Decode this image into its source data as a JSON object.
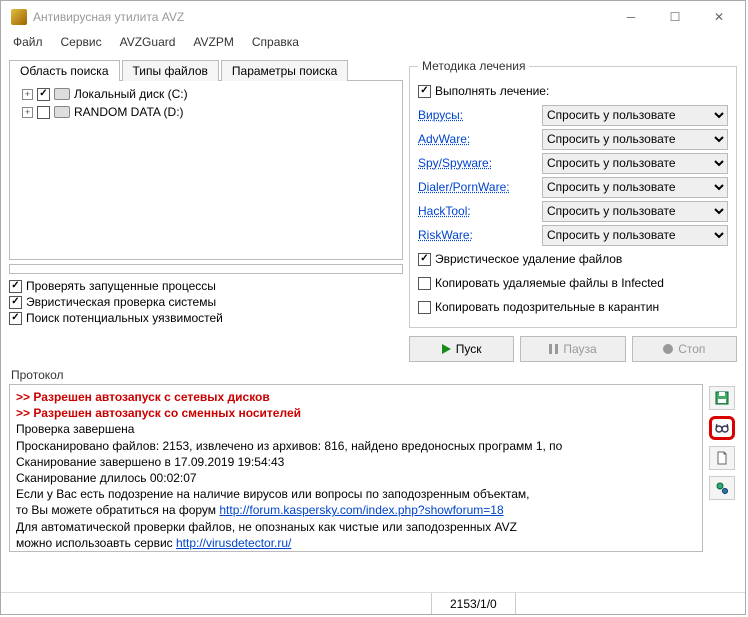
{
  "window": {
    "title": "Антивирусная утилита AVZ"
  },
  "menu": {
    "file": "Файл",
    "service": "Сервис",
    "avzguard": "AVZGuard",
    "avzpm": "AVZPM",
    "help": "Справка"
  },
  "tabs": {
    "area": "Область поиска",
    "types": "Типы файлов",
    "params": "Параметры поиска"
  },
  "tree": {
    "drive_c": "Локальный диск (C:)",
    "drive_d": "RANDOM DATA (D:)"
  },
  "checks": {
    "processes": "Проверять запущенные процессы",
    "heuristic": "Эвристическая проверка системы",
    "vuln": "Поиск потенциальных уязвимостей"
  },
  "cure": {
    "legend": "Методика лечения",
    "perform": "Выполнять лечение:",
    "rows": {
      "virus": "Вирусы:",
      "adware": "AdvWare:",
      "spy": "Spy/Spyware:",
      "dialer": "Dialer/PornWare:",
      "hacktool": "HackTool:",
      "riskware": "RiskWare:"
    },
    "ask": "Спросить у пользовате",
    "heur_del": "Эвристическое удаление файлов",
    "copy_inf": "Копировать удаляемые файлы в Infected",
    "copy_quar": "Копировать подозрительные в карантин"
  },
  "buttons": {
    "start": "Пуск",
    "pause": "Пауза",
    "stop": "Стоп"
  },
  "protocol": {
    "label": "Протокол",
    "l1": ">> Разрешен автозапуск с сетевых дисков",
    "l2": ">> Разрешен автозапуск со сменных носителей",
    "l3": "Проверка завершена",
    "l4": "Просканировано файлов: 2153, извлечено из архивов: 816, найдено вредоносных программ 1, по",
    "l5": "Сканирование завершено в 17.09.2019 19:54:43",
    "l6": "Сканирование длилось 00:02:07",
    "l7a": "Если у Вас есть подозрение на наличие вирусов или вопросы по заподозренным объектам,",
    "l7b": "то Вы можете обратиться на форум ",
    "l7c": "http://forum.kaspersky.com/index.php?showforum=18",
    "l8a": "Для автоматической проверки файлов, не опознаных как чистые или заподозренных AVZ",
    "l8b": "можно использоавть сервис ",
    "l8c": "http://virusdetector.ru/"
  },
  "status": {
    "counts": "2153/1/0"
  }
}
